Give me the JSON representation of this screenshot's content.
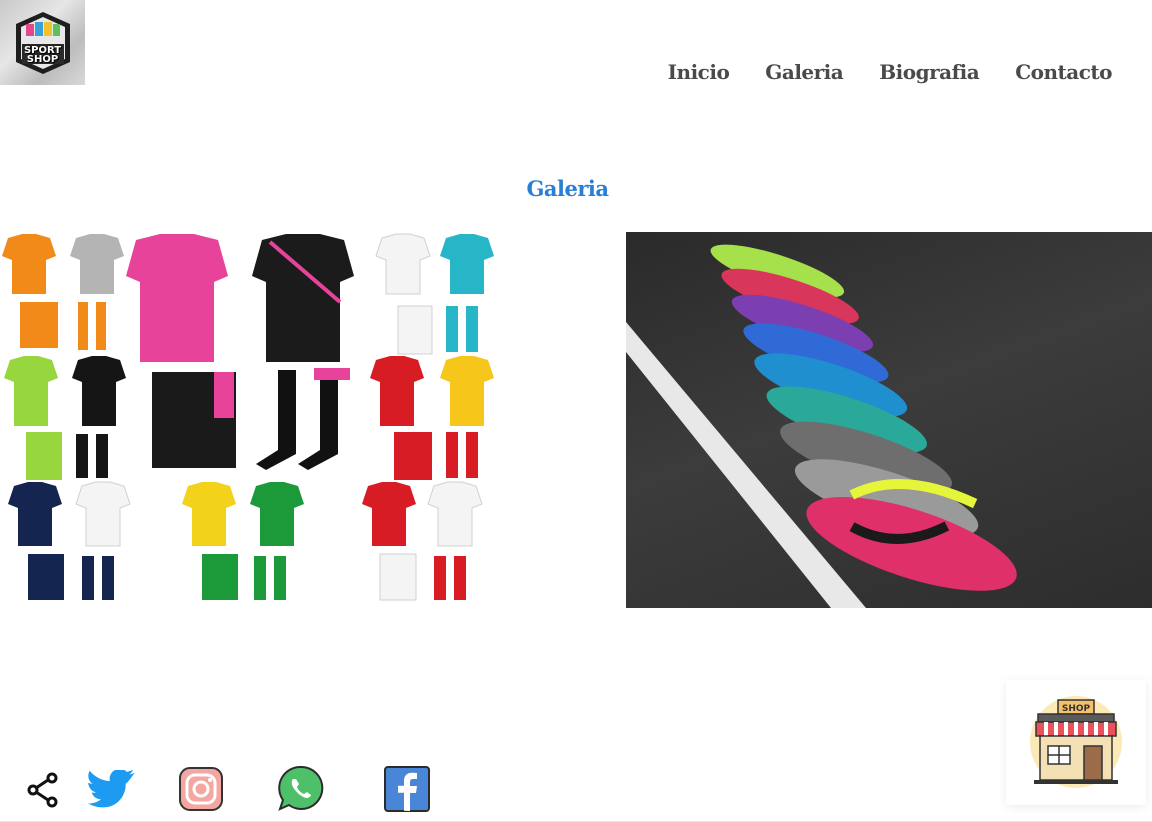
{
  "logo": {
    "line1": "SPORT",
    "line2": "SHOP"
  },
  "nav": [
    {
      "label": "Inicio"
    },
    {
      "label": "Galeria"
    },
    {
      "label": "Biografia"
    },
    {
      "label": "Contacto"
    }
  ],
  "gallery": {
    "title": "Galeria",
    "images": [
      {
        "name": "uniforms-image"
      },
      {
        "name": "sneakers-image"
      }
    ]
  },
  "shop_badge": {
    "label": "SHOP"
  },
  "social": {
    "icons": [
      "share-icon",
      "twitter-icon",
      "instagram-icon",
      "whatsapp-icon",
      "facebook-icon"
    ]
  },
  "colors": {
    "accent": "#2a7fd4",
    "nav_text": "#4a4a4a"
  }
}
